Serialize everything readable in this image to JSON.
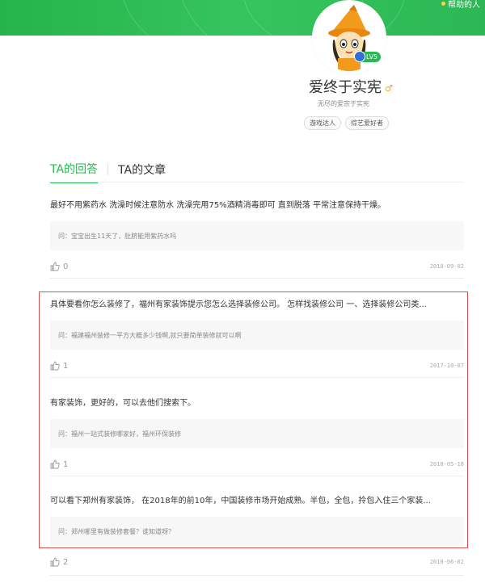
{
  "header": {
    "help_link": "帮助的人"
  },
  "profile": {
    "level": "LV5",
    "username": "爱终于实宪",
    "gender_symbol": "♂",
    "signature": "无尽的爱宗于实宪",
    "tags": [
      "游戏达人",
      "综艺爱好者"
    ]
  },
  "tabs": {
    "answers": "TA的回答",
    "articles": "TA的文章"
  },
  "answers": [
    {
      "text": "最好不用紫药水 洗澡时候注意防水 洗澡完用75%酒精消毒即可 直到脱落 平常注意保持干燥。",
      "question": "问：宝宝出生11天了，肚脐能用紫药水吗",
      "likes": "0",
      "date": "2018-09-02"
    },
    {
      "text": "具体要看你怎么装修了，福州有家装饰提示您怎么选择装修公司。 怎样找装修公司 一、选择装修公司类...",
      "question": "问：福建福州装修一平方大概多少钱啊,就只要简单装修就可以啊",
      "likes": "1",
      "date": "2017-10-07"
    },
    {
      "text": "有家装饰，更好的，可以去他们搜索下。",
      "question": "问：福州一站式装修哪家好，福州环保装修",
      "likes": "1",
      "date": "2018-05-18"
    },
    {
      "text": "可以看下郑州有家装饰， 在2018年的前10年，中国装修市场开始成熟。半包，全包，拎包入住三个家装...",
      "question": "问：郑州哪里有做装修套餐？谁知道呀？",
      "likes": "2",
      "date": "2018-06-02"
    }
  ]
}
